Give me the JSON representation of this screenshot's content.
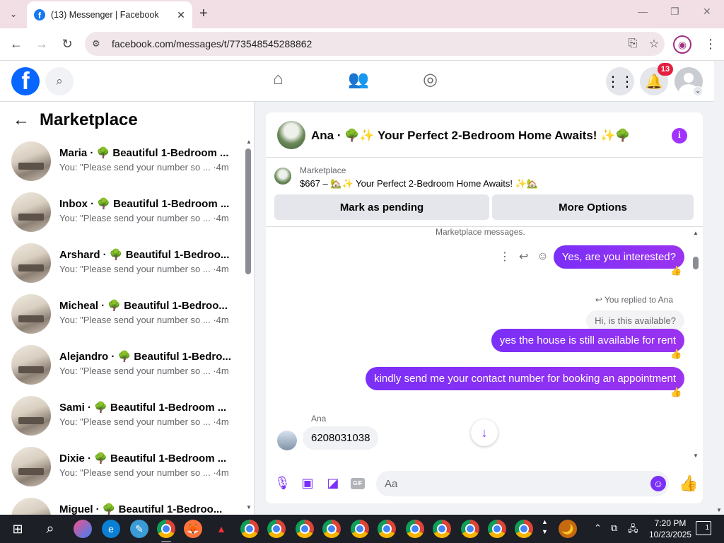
{
  "browser": {
    "tab_title": "(13) Messenger | Facebook",
    "url": "facebook.com/messages/t/773548545288862"
  },
  "fb_nav": {
    "notification_count": "13"
  },
  "sidebar": {
    "title": "Marketplace",
    "conversations": [
      {
        "name": "Maria · 🌳 Beautiful 1-Bedroom ...",
        "snippet": "You: \"Please send your number so ...",
        "time": "·4m"
      },
      {
        "name": "Inbox · 🌳 Beautiful 1-Bedroom ...",
        "snippet": "You: \"Please send your number so ...",
        "time": "·4m"
      },
      {
        "name": "Arshard · 🌳 Beautiful 1-Bedroo...",
        "snippet": "You: \"Please send your number so ...",
        "time": "·4m"
      },
      {
        "name": "Micheal · 🌳 Beautiful 1-Bedroo...",
        "snippet": "You: \"Please send your number so ...",
        "time": "·4m"
      },
      {
        "name": "Alejandro · 🌳 Beautiful 1-Bedro...",
        "snippet": "You: \"Please send your number so ...",
        "time": "·4m"
      },
      {
        "name": "Sami · 🌳 Beautiful 1-Bedroom ...",
        "snippet": "You: \"Please send your number so ...",
        "time": "·4m"
      },
      {
        "name": "Dixie · 🌳 Beautiful 1-Bedroom ...",
        "snippet": "You: \"Please send your number so ...",
        "time": "·4m"
      },
      {
        "name": "Miguel · 🌳 Beautiful 1-Bedroo...",
        "snippet": "",
        "time": ""
      }
    ]
  },
  "chat": {
    "header_title": "Ana · 🌳✨ Your Perfect 2-Bedroom Home Awaits! ✨🌳",
    "listing_source": "Marketplace",
    "listing_price_title": "$667 – 🏡✨ Your Perfect 2-Bedroom Home Awaits! ✨🏡",
    "mark_pending_label": "Mark as pending",
    "more_options_label": "More Options",
    "system_note": "Marketplace messages.",
    "messages": {
      "out1": "Yes, are you interested?",
      "replied_label": "You replied to Ana",
      "replied_quote": "Hi, is this available?",
      "out2": "yes the house is still available for rent",
      "out3": "kindly send me your contact number for booking an appointment",
      "in_sender": "Ana",
      "in1": "6208031038"
    },
    "composer_placeholder": "Aa",
    "accent_color": "#7b2ff7"
  },
  "taskbar": {
    "time": "7:20 PM",
    "date": "10/23/2025",
    "notification_count": "1"
  }
}
